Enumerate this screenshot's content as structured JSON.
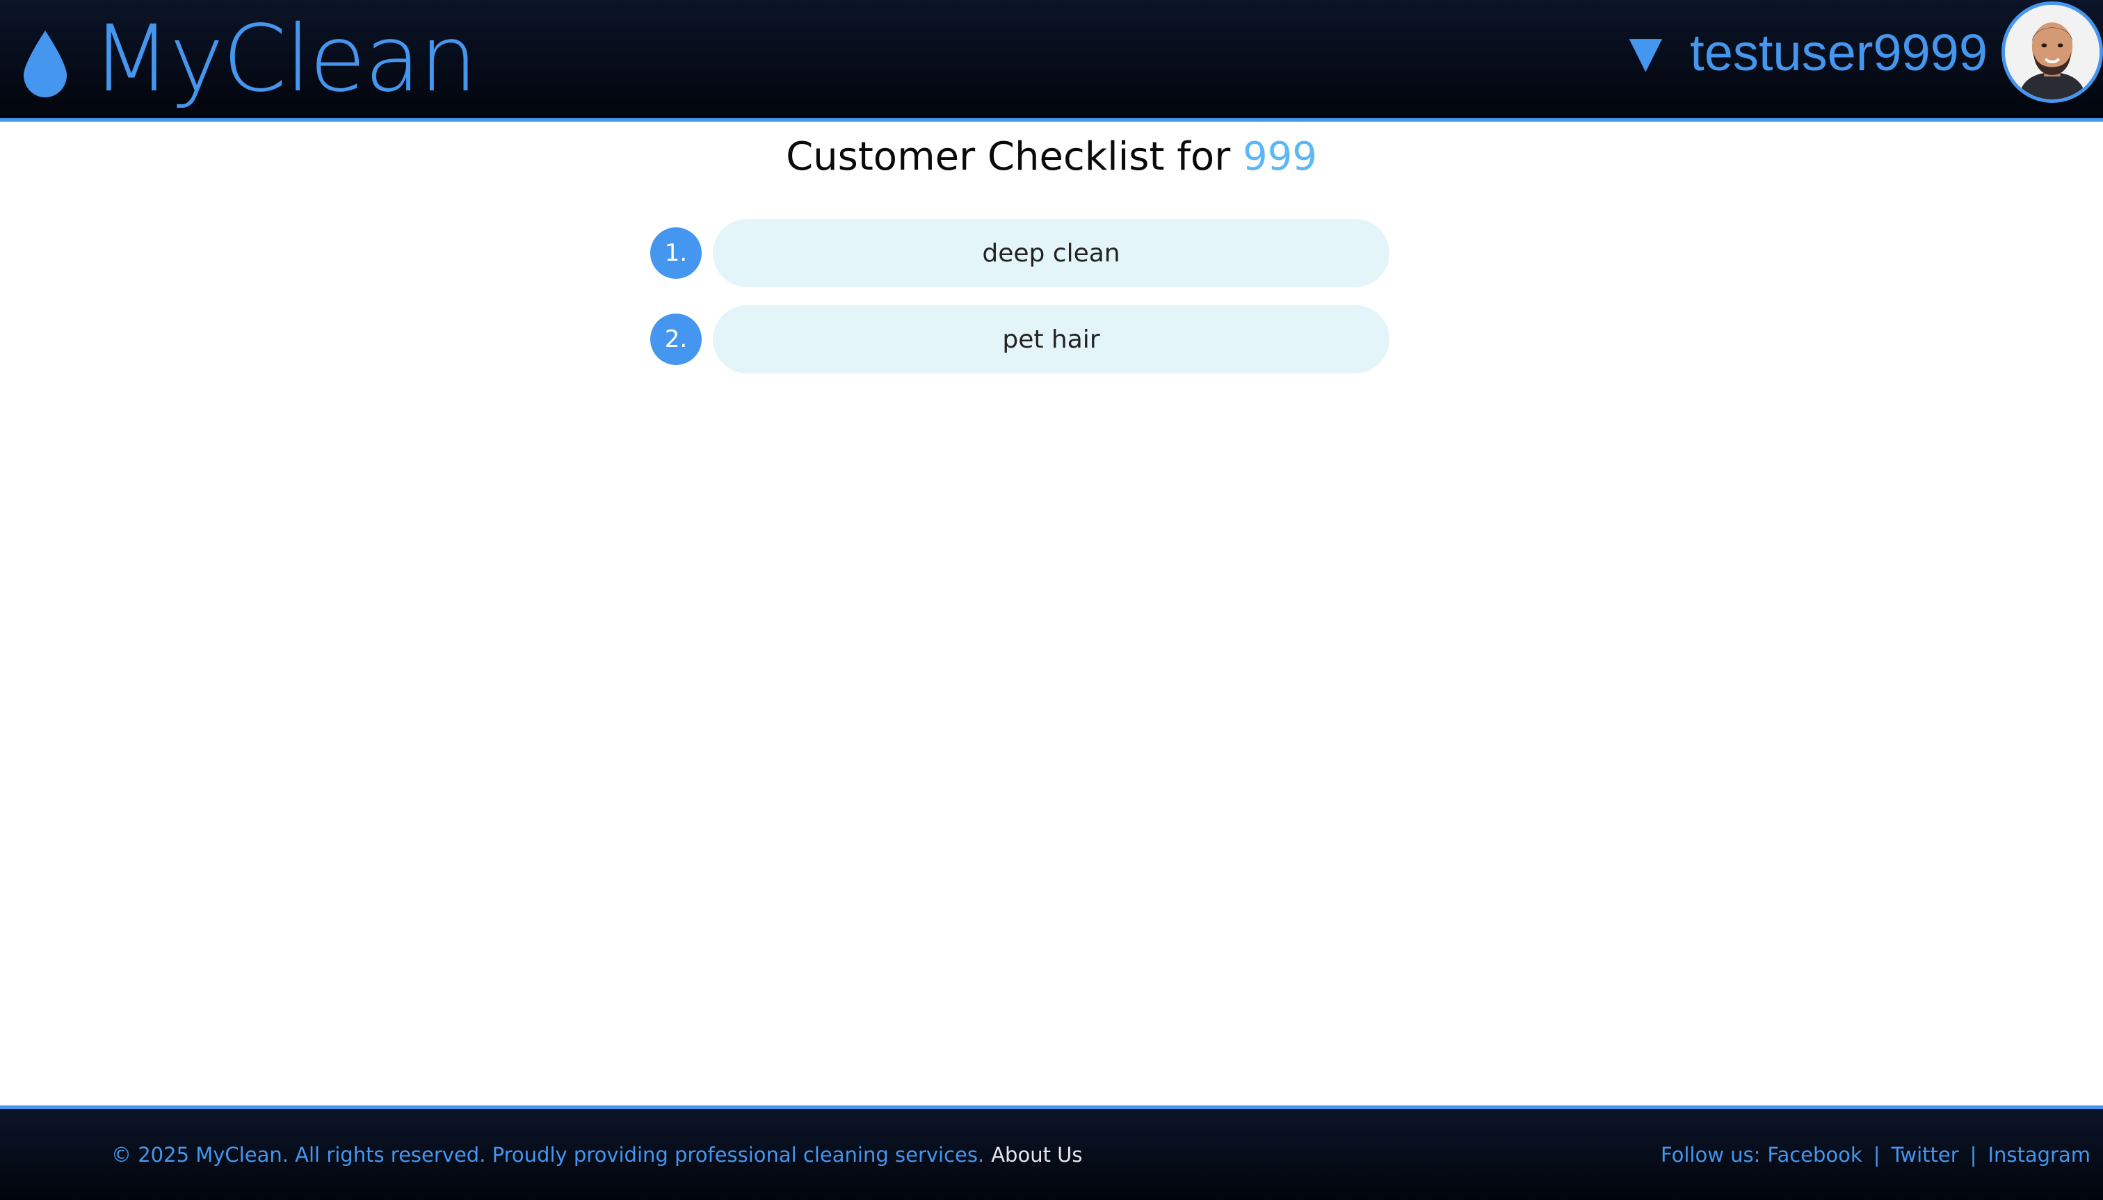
{
  "colors": {
    "accent": "#4596ee",
    "title_accent": "#5bb8f5",
    "header_bg": "#050a17",
    "pill_bg": "#e4f5f9",
    "footer_white_link": "#e6e6e6"
  },
  "header": {
    "logo_icon": "water-drop-icon",
    "logo_text": "MyClean",
    "user_menu_icon": "caret-down-icon",
    "username": "testuser9999",
    "avatar_icon": "user-avatar"
  },
  "main": {
    "title_prefix": "Customer Checklist for",
    "title_id": "999",
    "checklist": [
      {
        "number": "1.",
        "text": "deep clean"
      },
      {
        "number": "2.",
        "text": "pet hair"
      }
    ]
  },
  "footer": {
    "copyright": "© 2025 MyClean. All rights reserved. Proudly providing professional cleaning services.",
    "about_link": "About Us",
    "follow_label": "Follow us:",
    "social_links": [
      "Facebook",
      "Twitter",
      "Instagram"
    ],
    "separator": "|"
  }
}
